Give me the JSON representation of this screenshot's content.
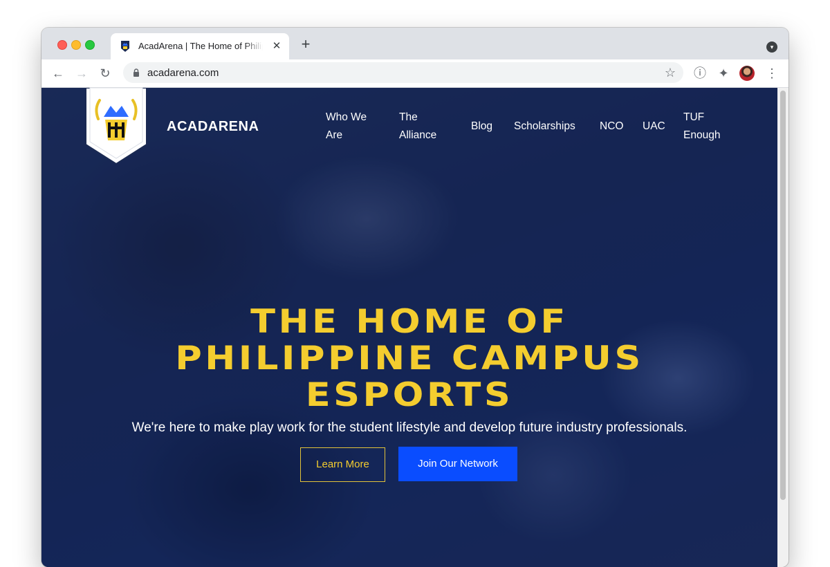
{
  "browser": {
    "tab": {
      "title": "AcadArena | The Home of Philippine Campus Esports",
      "close_glyph": "✕",
      "favicon_icon": "acadarena-favicon-icon"
    },
    "new_tab_glyph": "+",
    "url": "acadarena.com",
    "icons": {
      "back": "←",
      "forward": "→",
      "reload": "↻",
      "star": "☆",
      "info": "ⓘ",
      "extensions": "✦",
      "menu": "⋮",
      "tab_search": "▾"
    }
  },
  "site": {
    "brand": "ACADARENA",
    "nav": [
      {
        "label": "Who We Are"
      },
      {
        "label": "The Alliance"
      },
      {
        "label": "Blog"
      },
      {
        "label": "Scholarships"
      },
      {
        "label": "NCO"
      },
      {
        "label": "UAC"
      },
      {
        "label": "TUF Enough"
      }
    ],
    "hero": {
      "headline_line1": "THE HOME OF",
      "headline_line2": "PHILIPPINE CAMPUS",
      "headline_line3": "ESPORTS",
      "subtitle": "We're here to make play work for the student lifestyle and develop future industry professionals.",
      "learn_more": "Learn More",
      "join_network": "Join Our Network"
    }
  },
  "colors": {
    "accent_yellow": "#f4cd2f",
    "button_blue": "#0a4dff",
    "hero_overlay": "#102154"
  }
}
